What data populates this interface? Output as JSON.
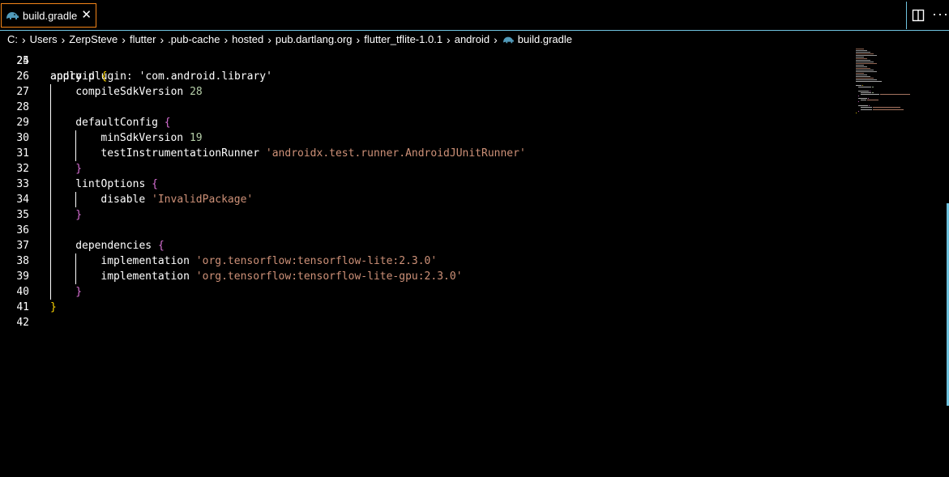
{
  "tab": {
    "label": "build.gradle",
    "close_glyph": "✕",
    "icon": "gradle-elephant-icon"
  },
  "toolbar": {
    "split_icon": "split-editor-icon",
    "more_glyph": "···"
  },
  "breadcrumb": [
    "C:",
    "Users",
    "ZerpSteve",
    "flutter",
    ".pub-cache",
    "hosted",
    "pub.dartlang.org",
    "flutter_tflite-1.0.1",
    "android",
    "build.gradle"
  ],
  "editor": {
    "partial_line": {
      "num": "24",
      "text": "apply plugin: 'com.android.library'"
    },
    "lines": [
      {
        "num": "25",
        "indent": 0,
        "tokens": []
      },
      {
        "num": "26",
        "indent": 0,
        "tokens": [
          {
            "t": "android ",
            "c": "kw"
          },
          {
            "t": "{",
            "c": "b1"
          }
        ]
      },
      {
        "num": "27",
        "indent": 1,
        "tokens": [
          {
            "t": "compileSdkVersion ",
            "c": "kw"
          },
          {
            "t": "28",
            "c": "num"
          }
        ]
      },
      {
        "num": "28",
        "indent": 0,
        "tokens": []
      },
      {
        "num": "29",
        "indent": 1,
        "tokens": [
          {
            "t": "defaultConfig ",
            "c": "kw"
          },
          {
            "t": "{",
            "c": "b2"
          }
        ]
      },
      {
        "num": "30",
        "indent": 2,
        "tokens": [
          {
            "t": "minSdkVersion ",
            "c": "kw"
          },
          {
            "t": "19",
            "c": "num"
          }
        ]
      },
      {
        "num": "31",
        "indent": 2,
        "tokens": [
          {
            "t": "testInstrumentationRunner ",
            "c": "kw"
          },
          {
            "t": "'androidx.test.runner.AndroidJUnitRunner'",
            "c": "str"
          }
        ]
      },
      {
        "num": "32",
        "indent": 1,
        "tokens": [
          {
            "t": "}",
            "c": "b2"
          }
        ]
      },
      {
        "num": "33",
        "indent": 1,
        "tokens": [
          {
            "t": "lintOptions ",
            "c": "kw"
          },
          {
            "t": "{",
            "c": "b2"
          }
        ]
      },
      {
        "num": "34",
        "indent": 2,
        "tokens": [
          {
            "t": "disable ",
            "c": "kw"
          },
          {
            "t": "'InvalidPackage'",
            "c": "str"
          }
        ]
      },
      {
        "num": "35",
        "indent": 1,
        "tokens": [
          {
            "t": "}",
            "c": "b2"
          }
        ]
      },
      {
        "num": "36",
        "indent": 0,
        "tokens": []
      },
      {
        "num": "37",
        "indent": 1,
        "tokens": [
          {
            "t": "dependencies ",
            "c": "kw"
          },
          {
            "t": "{",
            "c": "b2"
          }
        ]
      },
      {
        "num": "38",
        "indent": 2,
        "tokens": [
          {
            "t": "implementation ",
            "c": "kw"
          },
          {
            "t": "'org.tensorflow:tensorflow-lite:2.3.0'",
            "c": "str"
          }
        ]
      },
      {
        "num": "39",
        "indent": 2,
        "tokens": [
          {
            "t": "implementation ",
            "c": "kw"
          },
          {
            "t": "'org.tensorflow:tensorflow-lite-gpu:2.3.0'",
            "c": "str"
          }
        ]
      },
      {
        "num": "40",
        "indent": 1,
        "tokens": [
          {
            "t": "}",
            "c": "b2"
          }
        ]
      },
      {
        "num": "41",
        "indent": 0,
        "tokens": [
          {
            "t": "}",
            "c": "b1"
          }
        ]
      },
      {
        "num": "42",
        "indent": 0,
        "tokens": []
      }
    ]
  },
  "colors": {
    "accent_border": "#6fc3df",
    "active_tab_border": "#f38518",
    "string": "#ce9178",
    "number": "#b5cea8",
    "bracket_level1": "#ffd700",
    "bracket_level2": "#da70d6",
    "icon": "#519aba"
  }
}
